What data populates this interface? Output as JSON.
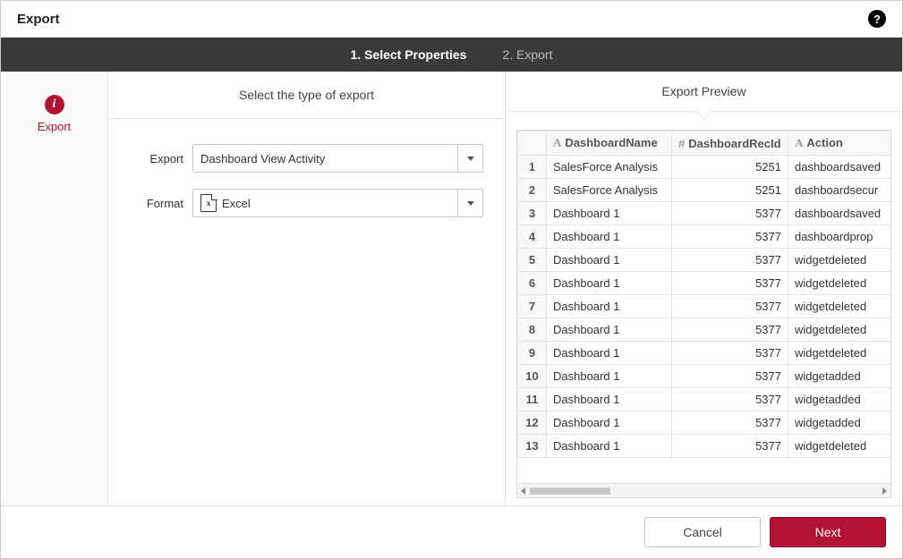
{
  "dialog": {
    "title": "Export",
    "help_glyph": "?"
  },
  "steps": {
    "step1": "1. Select Properties",
    "step2": "2. Export"
  },
  "sidebar": {
    "info_glyph": "i",
    "label": "Export"
  },
  "left": {
    "title": "Select the type of export",
    "export_label": "Export",
    "export_value": "Dashboard View Activity",
    "format_label": "Format",
    "format_value": "Excel",
    "xls_glyph": "x"
  },
  "right": {
    "title": "Export Preview"
  },
  "table": {
    "col_text_glyph": "A",
    "col_num_glyph": "#",
    "headers": [
      "DashboardName",
      "DashboardRecId",
      "Action"
    ],
    "rows": [
      {
        "n": "1",
        "name": "SalesForce Analysis",
        "rec": "5251",
        "act": "dashboardsaved"
      },
      {
        "n": "2",
        "name": "SalesForce Analysis",
        "rec": "5251",
        "act": "dashboardsecur"
      },
      {
        "n": "3",
        "name": "Dashboard 1",
        "rec": "5377",
        "act": "dashboardsaved"
      },
      {
        "n": "4",
        "name": "Dashboard 1",
        "rec": "5377",
        "act": "dashboardprop"
      },
      {
        "n": "5",
        "name": "Dashboard 1",
        "rec": "5377",
        "act": "widgetdeleted"
      },
      {
        "n": "6",
        "name": "Dashboard 1",
        "rec": "5377",
        "act": "widgetdeleted"
      },
      {
        "n": "7",
        "name": "Dashboard 1",
        "rec": "5377",
        "act": "widgetdeleted"
      },
      {
        "n": "8",
        "name": "Dashboard 1",
        "rec": "5377",
        "act": "widgetdeleted"
      },
      {
        "n": "9",
        "name": "Dashboard 1",
        "rec": "5377",
        "act": "widgetdeleted"
      },
      {
        "n": "10",
        "name": "Dashboard 1",
        "rec": "5377",
        "act": "widgetadded"
      },
      {
        "n": "11",
        "name": "Dashboard 1",
        "rec": "5377",
        "act": "widgetadded"
      },
      {
        "n": "12",
        "name": "Dashboard 1",
        "rec": "5377",
        "act": "widgetadded"
      },
      {
        "n": "13",
        "name": "Dashboard 1",
        "rec": "5377",
        "act": "widgetdeleted"
      }
    ]
  },
  "footer": {
    "cancel": "Cancel",
    "next": "Next"
  }
}
